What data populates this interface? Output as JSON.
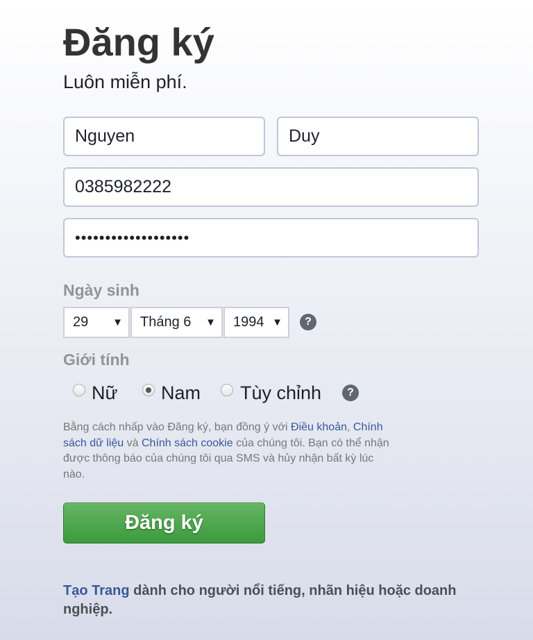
{
  "header": {
    "title": "Đăng ký",
    "subtitle": "Luôn miễn phí."
  },
  "form": {
    "first_name": "Nguyen",
    "last_name": "Duy",
    "phone": "0385982222",
    "password_masked": "•••••••••••••••••••"
  },
  "birthday": {
    "label": "Ngày sinh",
    "day": "29",
    "month": "Tháng 6",
    "year": "1994",
    "help": "?"
  },
  "gender": {
    "label": "Giới tính",
    "options": [
      "Nữ",
      "Nam",
      "Tùy chỉnh"
    ],
    "selected": "Nam",
    "help": "?"
  },
  "terms": {
    "part1": "Bằng cách nhấp vào Đăng ký, bạn đồng ý với ",
    "link_terms": "Điều khoản",
    "part2": ", ",
    "link_data_policy": "Chính sách dữ liệu",
    "part3": " và ",
    "link_cookie_policy": "Chính sách cookie",
    "part4": " của chúng tôi. Bạn có thể nhận được thông báo của chúng tôi qua SMS và hủy nhận bất kỳ lúc nào."
  },
  "signup_button": "Đăng ký",
  "footer": {
    "link_create_page": "Tạo Trang",
    "text": " dành cho người nổi tiếng, nhãn hiệu hoặc doanh nghiệp."
  },
  "colors": {
    "link": "#385898",
    "button_green": "#4fa84f",
    "label_gray": "#90949c"
  }
}
